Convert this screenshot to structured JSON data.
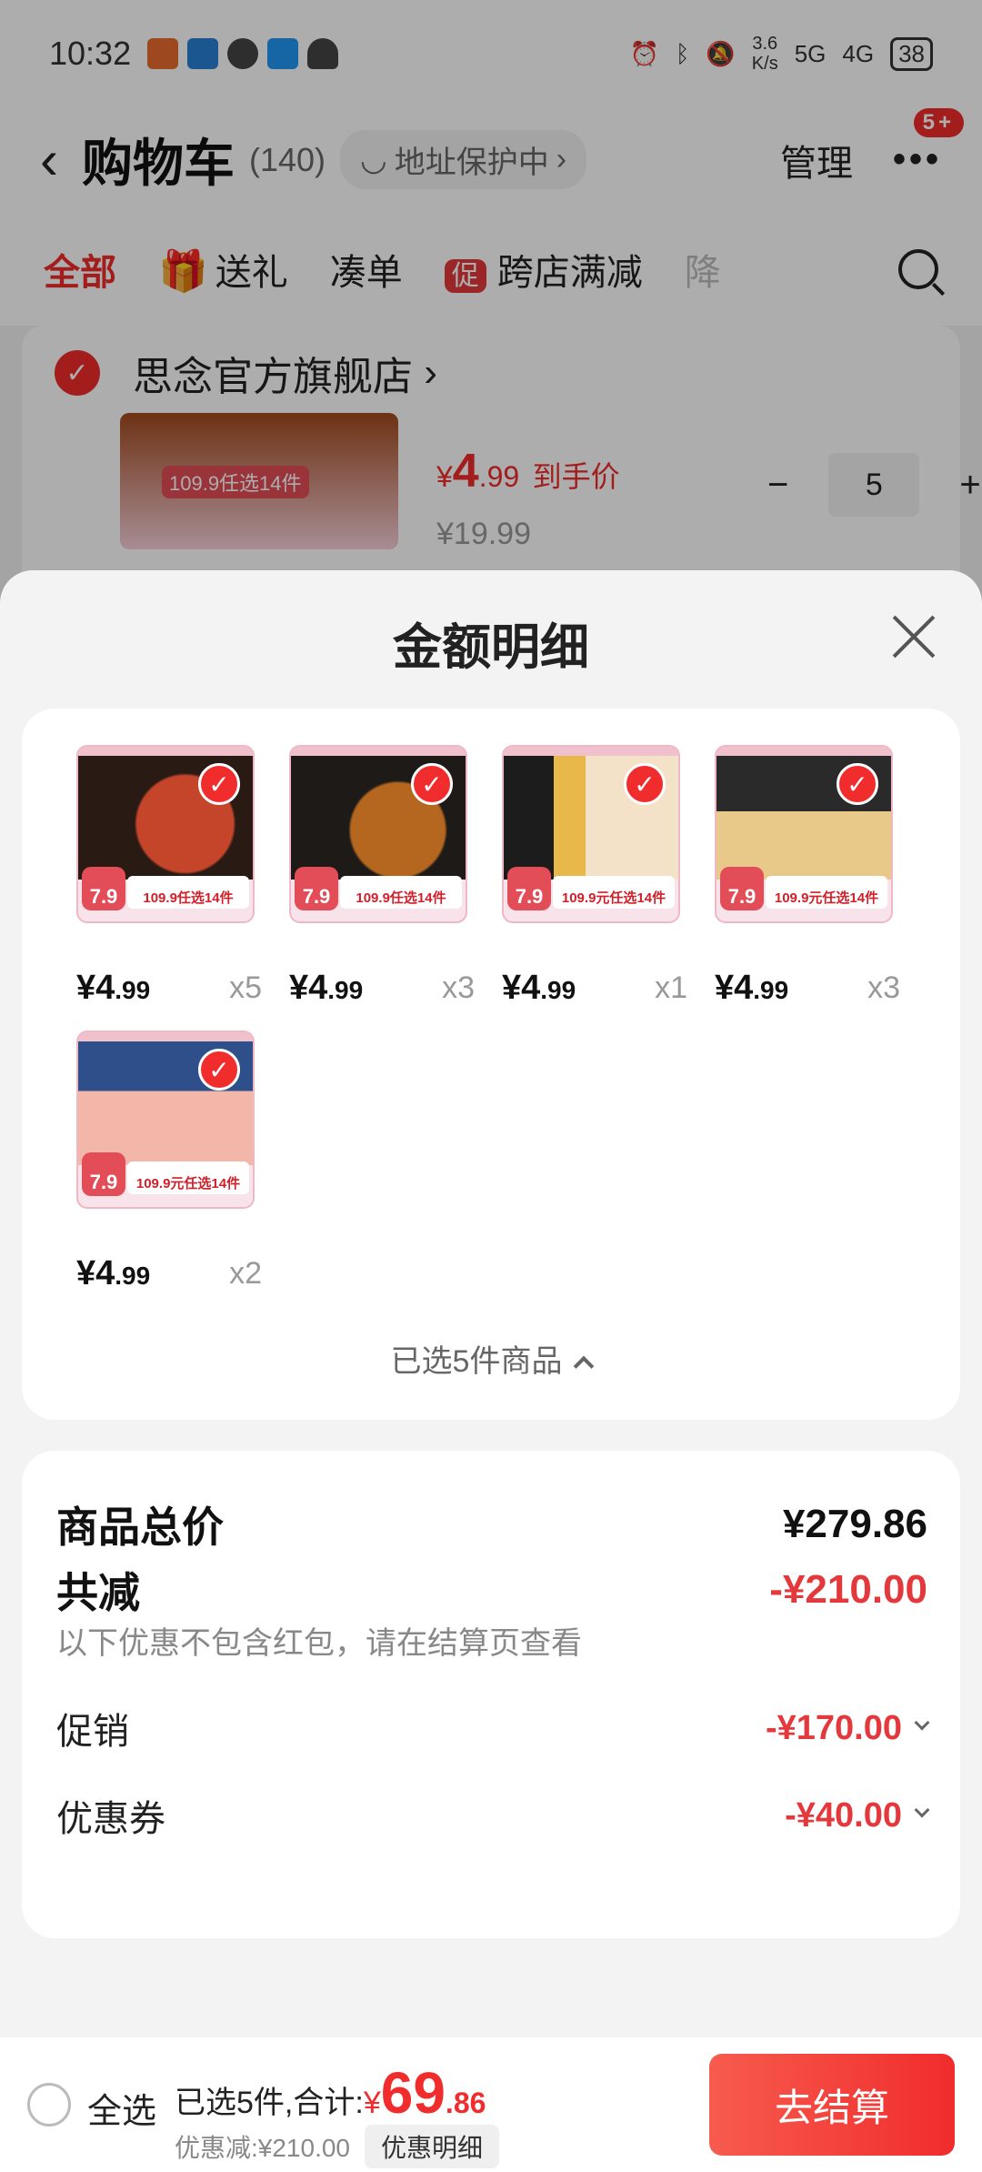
{
  "status_bar": {
    "time": "10:32",
    "net_speed_top": "3.6",
    "net_speed_bottom": "K/s",
    "signal_1": "5G",
    "signal_2": "4G",
    "battery": "38"
  },
  "cart_header": {
    "title": "购物车",
    "count": "(140)",
    "address_protect": "地址保护中",
    "manage": "管理",
    "more_badge": "5+"
  },
  "tabs": [
    {
      "label": "全部"
    },
    {
      "label": "送礼"
    },
    {
      "label": "凑单"
    },
    {
      "label": "跨店满减",
      "tag": "促"
    },
    {
      "label": "降"
    }
  ],
  "store": {
    "name": "思念官方旗舰店",
    "item": {
      "price_symbol": "¥",
      "price_int": "4",
      "price_dec": ".99",
      "price_suffix": "到手价",
      "orig_price": "¥19.99",
      "quantity": "5",
      "thumb_tag": "109.9任选14件"
    }
  },
  "sheet": {
    "title": "金额明细",
    "items": [
      {
        "price_int": "4",
        "price_dec": ".99",
        "qty": "x5",
        "promo": "109.9任选14件",
        "ref": "7.9"
      },
      {
        "price_int": "4",
        "price_dec": ".99",
        "qty": "x3",
        "promo": "109.9任选14件",
        "ref": "7.9"
      },
      {
        "price_int": "4",
        "price_dec": ".99",
        "qty": "x1",
        "promo": "109.9元任选14件",
        "ref": "7.9"
      },
      {
        "price_int": "4",
        "price_dec": ".99",
        "qty": "x3",
        "promo": "109.9元任选14件",
        "ref": "7.9"
      },
      {
        "price_int": "4",
        "price_dec": ".99",
        "qty": "x2",
        "promo": "109.9元任选14件",
        "ref": "7.9"
      }
    ],
    "selected_summary": "已选5件商品",
    "totals": {
      "goods_total_label": "商品总价",
      "goods_total_value": "¥279.86",
      "reduction_label": "共减",
      "reduction_value": "-¥210.00",
      "reduction_note": "以下优惠不包含红包，请在结算页查看",
      "promo_label": "促销",
      "promo_value": "-¥170.00",
      "coupon_label": "优惠券",
      "coupon_value": "-¥40.00"
    }
  },
  "bottom_bar": {
    "select_all": "全选",
    "summary_prefix": "已选5件,合计:",
    "currency": "¥",
    "total_int": "69",
    "total_dec": ".86",
    "discount": "优惠减:¥210.00",
    "detail_chip": "优惠明细",
    "checkout": "去结算"
  },
  "colors": {
    "accent": "#f02c2c",
    "price_red": "#e4393c"
  }
}
